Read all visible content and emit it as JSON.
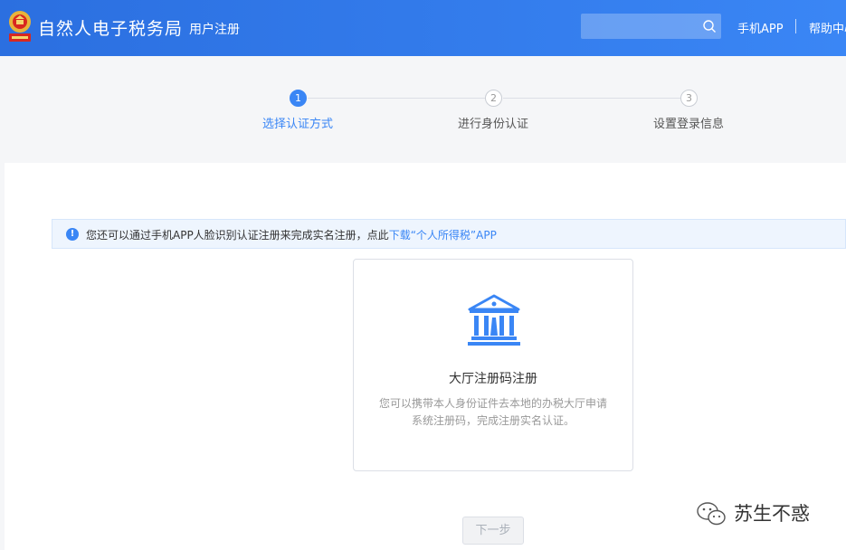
{
  "header": {
    "title": "自然人电子税务局",
    "subtitle": "用户注册",
    "search_placeholder": "",
    "nav_app": "手机APP",
    "nav_help": "帮助中心",
    "brand_color": "#3a86f5"
  },
  "steps": {
    "current": 1,
    "items": [
      {
        "number": "1",
        "label": "选择认证方式"
      },
      {
        "number": "2",
        "label": "进行身份认证"
      },
      {
        "number": "3",
        "label": "设置登录信息"
      }
    ]
  },
  "notice": {
    "icon": "info-icon",
    "text": "您还可以通过手机APP人脸识别认证注册来完成实名注册，点此",
    "link": "下载“个人所得税”APP"
  },
  "option_card": {
    "icon": "bank-building-icon",
    "title": "大厅注册码注册",
    "desc_line1": "您可以携带本人身份证件去本地的办税大厅申请",
    "desc_line2": "系统注册码，完成注册实名认证。"
  },
  "next_button": {
    "label": "下一步",
    "enabled": false
  },
  "watermark": {
    "text": "苏生不惑",
    "icon": "wechat-icon"
  }
}
